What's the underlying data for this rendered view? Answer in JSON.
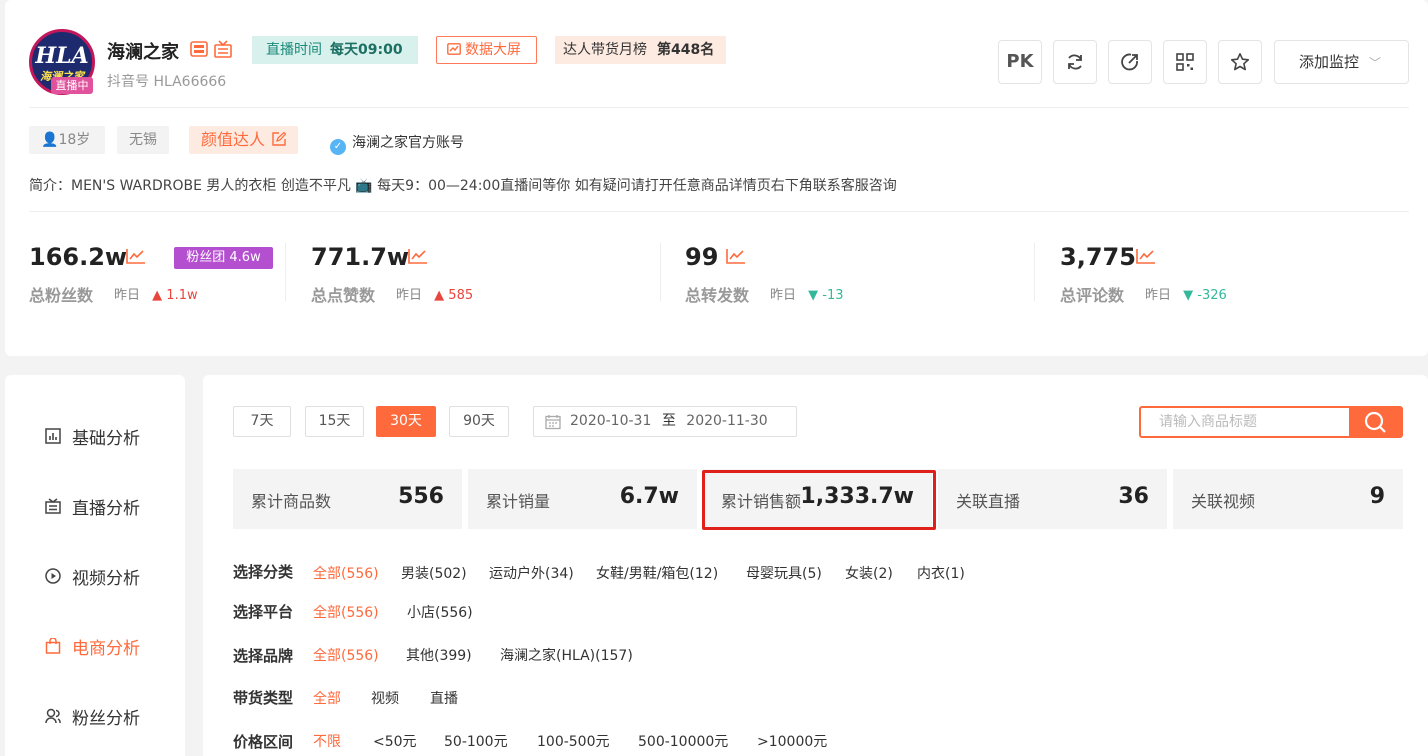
{
  "profile": {
    "avatar_text": "HLA",
    "avatar_sub": "海澜之家",
    "live_badge": "直播中",
    "name": "海澜之家",
    "douyin_id": "抖音号 HLA66666",
    "live_time_label": "直播时间",
    "live_time_value": "每天09:00",
    "data_screen": "数据大屏",
    "rank_label": "达人带货月榜",
    "rank_value": "第448名"
  },
  "toolbar": {
    "pk": "PK",
    "monitor": "添加监控"
  },
  "tags": {
    "age": "18岁",
    "city": "无锡",
    "category": "颜值达人",
    "verified": "海澜之家官方账号"
  },
  "bio": "简介：MEN'S WARDROBE 男人的衣柜 创造不平凡 📺 每天9：00—24:00直播间等你 如有疑问请打开任意商品详情页右下角联系客服咨询",
  "stats": [
    {
      "value": "166.2w",
      "label": "总粉丝数",
      "yest_label": "昨日",
      "delta": "1.1w",
      "dir": "up",
      "arrow": "▲"
    },
    {
      "value": "771.7w",
      "label": "总点赞数",
      "yest_label": "昨日",
      "delta": "585",
      "dir": "up",
      "arrow": "▲"
    },
    {
      "value": "99",
      "label": "总转发数",
      "yest_label": "昨日",
      "delta": "-13",
      "dir": "down",
      "arrow": "▼"
    },
    {
      "value": "3,775",
      "label": "总评论数",
      "yest_label": "昨日",
      "delta": "-326",
      "dir": "down",
      "arrow": "▼"
    }
  ],
  "fans_group": "粉丝团 4.6w",
  "sidebar": {
    "items": [
      {
        "label": "基础分析"
      },
      {
        "label": "直播分析"
      },
      {
        "label": "视频分析"
      },
      {
        "label": "电商分析"
      },
      {
        "label": "粉丝分析"
      }
    ]
  },
  "ranges": [
    "7天",
    "15天",
    "30天",
    "90天"
  ],
  "date_range": {
    "start": "2020-10-31",
    "sep": "至",
    "end": "2020-11-30"
  },
  "search": {
    "placeholder": "请输入商品标题"
  },
  "summary": [
    {
      "label": "累计商品数",
      "value": "556"
    },
    {
      "label": "累计销量",
      "value": "6.7w"
    },
    {
      "label": "累计销售额",
      "value": "1,333.7w"
    },
    {
      "label": "关联直播",
      "value": "36"
    },
    {
      "label": "关联视频",
      "value": "9"
    }
  ],
  "filters": [
    {
      "label": "选择分类",
      "options": [
        "全部(556)",
        "男装(502)",
        "运动户外(34)",
        "女鞋/男鞋/箱包(12)",
        "母婴玩具(5)",
        "女装(2)",
        "内衣(1)"
      ]
    },
    {
      "label": "选择平台",
      "options": [
        "全部(556)",
        "小店(556)"
      ]
    },
    {
      "label": "选择品牌",
      "options": [
        "全部(556)",
        "其他(399)",
        "海澜之家(HLA)(157)"
      ]
    },
    {
      "label": "带货类型",
      "options": [
        "全部",
        "视频",
        "直播"
      ]
    },
    {
      "label": "价格区间",
      "options": [
        "不限",
        "<50元",
        "50-100元",
        "100-500元",
        "500-10000元",
        ">10000元"
      ]
    }
  ]
}
